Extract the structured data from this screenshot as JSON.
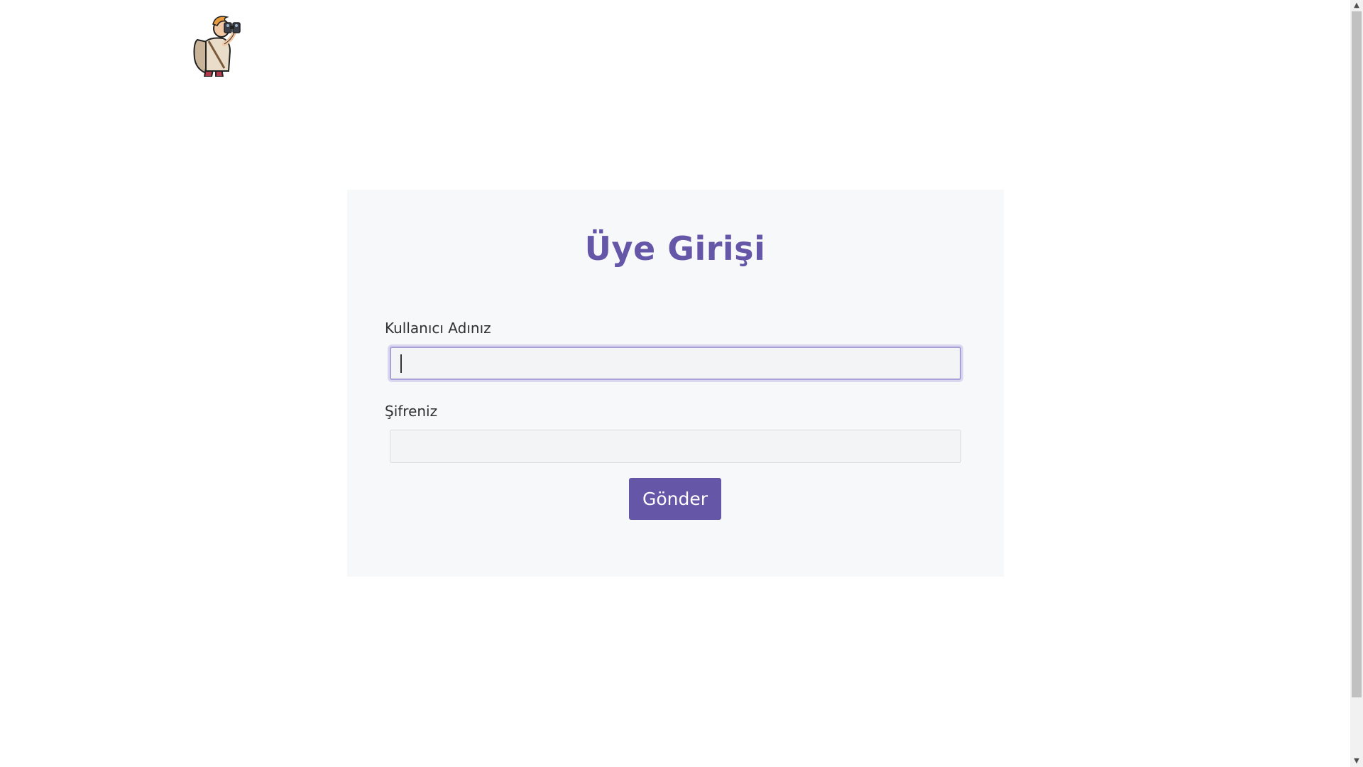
{
  "logo": {
    "icon": "explorer-with-binoculars-icon"
  },
  "login": {
    "title": "Üye Girişi",
    "username_label": "Kullanıcı Adınız",
    "username_value": "",
    "password_label": "Şifreniz",
    "password_value": "",
    "submit_label": "Gönder"
  },
  "colors": {
    "accent": "#6556a8",
    "card_bg": "#f7f8f9",
    "focus_ring": "#a9a0d6"
  },
  "scrollbar": {
    "up_icon": "chevron-up-icon",
    "down_icon": "chevron-down-icon"
  }
}
